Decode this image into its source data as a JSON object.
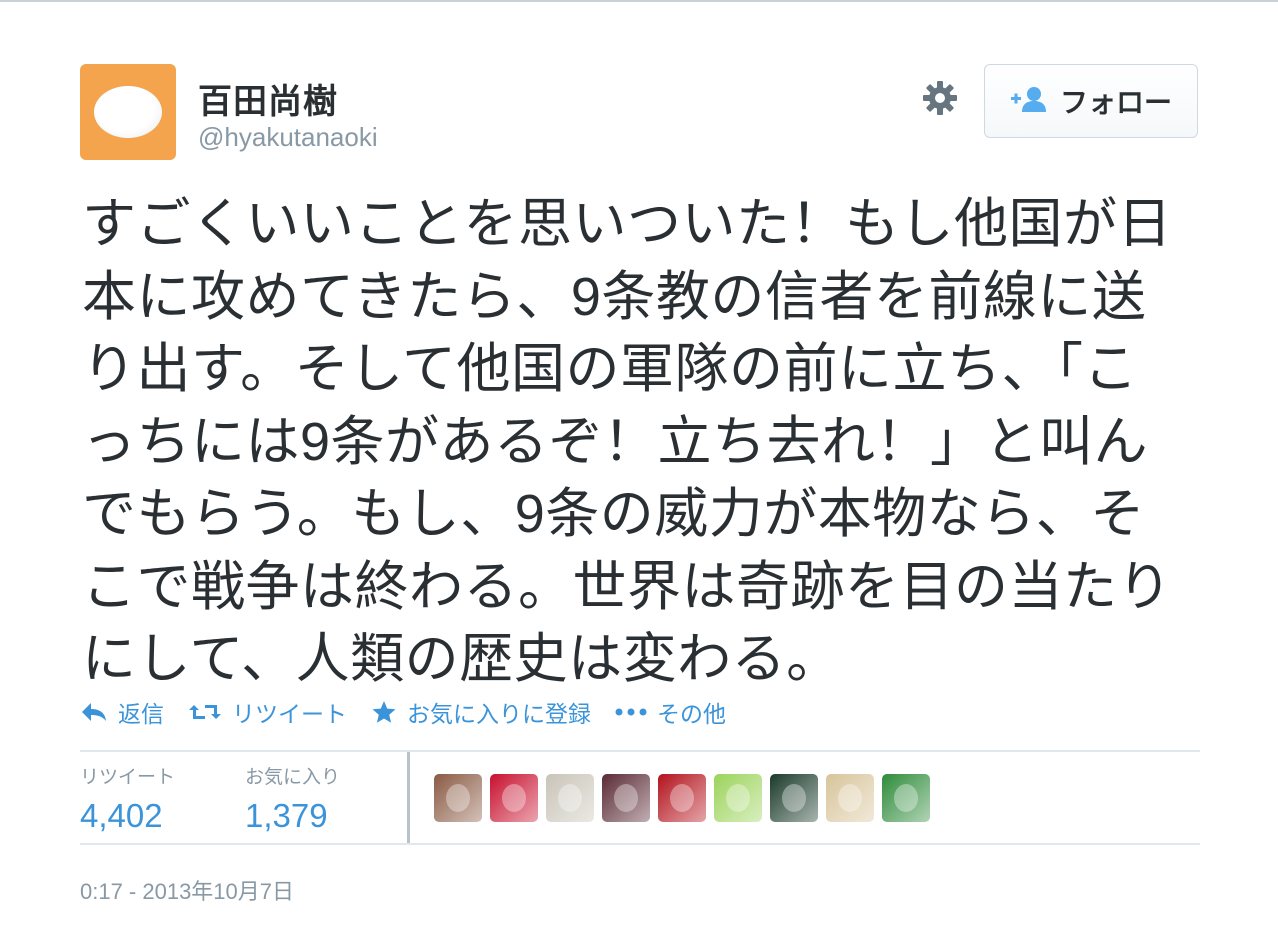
{
  "user": {
    "fullname": "百田尚樹",
    "username": "@hyakutanaoki"
  },
  "follow_button": {
    "label": "フォロー",
    "icon": "add-user-icon"
  },
  "settings": {
    "icon": "gear-icon"
  },
  "tweet": {
    "text": "すごくいいことを思いついた！もし他国が日\n本に攻めてきたら、9条教の信者を前線に送\nり出す。そして他国の軍隊の前に立ち、「こ\nっちには9条があるぞ！立ち去れ！」と叫ん\nでもらう。もし、9条の威力が本物なら、そ\nこで戦争は終わる。世界は奇跡を目の当たり\nにして、人類の歴史は変わる。"
  },
  "actions": {
    "reply": {
      "label": "返信",
      "icon": "reply-icon"
    },
    "retweet": {
      "label": "リツイート",
      "icon": "retweet-icon"
    },
    "favorite": {
      "label": "お気に入りに登録",
      "icon": "star-icon"
    },
    "more": {
      "label": "その他",
      "icon": "more-dots-icon"
    }
  },
  "stats": {
    "retweets": {
      "label": "リツイート",
      "value": "4,402"
    },
    "favorites": {
      "label": "お気に入り",
      "value": "1,379"
    }
  },
  "favoriters": [
    {
      "name": "favoriter-avatar-1",
      "color": "#8a5a44"
    },
    {
      "name": "favoriter-avatar-2",
      "color": "#c8102e"
    },
    {
      "name": "favoriter-avatar-3",
      "color": "#c9c4b8"
    },
    {
      "name": "favoriter-avatar-4",
      "color": "#5a2a35"
    },
    {
      "name": "favoriter-avatar-5",
      "color": "#b3121c"
    },
    {
      "name": "favoriter-avatar-6",
      "color": "#9bd35a"
    },
    {
      "name": "favoriter-avatar-7",
      "color": "#1a3a2a"
    },
    {
      "name": "favoriter-avatar-8",
      "color": "#d8c49a"
    },
    {
      "name": "favoriter-avatar-9",
      "color": "#2e8b3a"
    }
  ],
  "timestamp": "0:17 - 2013年10月7日",
  "colors": {
    "link": "#3b94d9",
    "muted": "#8899a6",
    "text": "#292f33",
    "avatar_bg": "#f4a44c"
  }
}
